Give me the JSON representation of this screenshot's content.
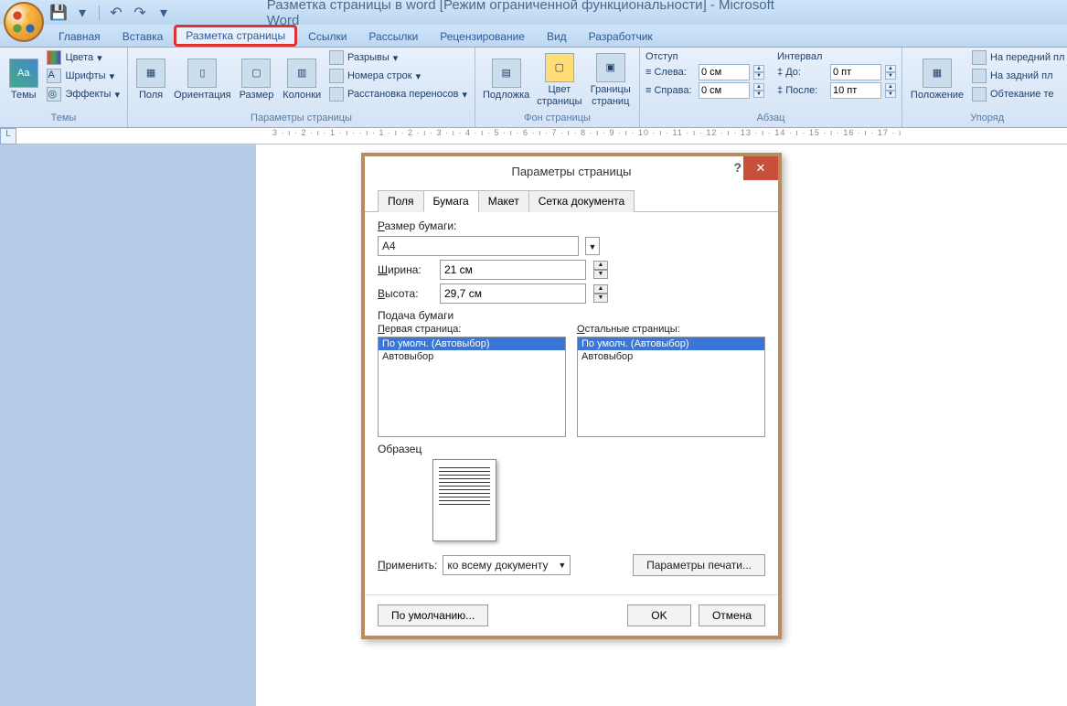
{
  "title": "Разметка страницы в word [Режим ограниченной функциональности] - Microsoft Word",
  "tabs": {
    "home": "Главная",
    "insert": "Вставка",
    "layout": "Разметка страницы",
    "refs": "Ссылки",
    "mail": "Рассылки",
    "review": "Рецензирование",
    "view": "Вид",
    "developer": "Разработчик"
  },
  "ribbon": {
    "themes": {
      "label": "Темы",
      "themes_btn": "Темы",
      "colors": "Цвета",
      "fonts": "Шрифты",
      "effects": "Эффекты"
    },
    "page_setup": {
      "label": "Параметры страницы",
      "margins": "Поля",
      "orientation": "Ориентация",
      "size": "Размер",
      "columns": "Колонки",
      "breaks": "Разрывы",
      "line_numbers": "Номера строк",
      "hyphenation": "Расстановка переносов"
    },
    "page_bg": {
      "label": "Фон страницы",
      "watermark": "Подложка",
      "page_color": "Цвет страницы",
      "borders": "Границы страниц"
    },
    "paragraph": {
      "label": "Абзац",
      "indent_title": "Отступ",
      "left": "Слева:",
      "right": "Справа:",
      "spacing_title": "Интервал",
      "before": "До:",
      "after": "После:",
      "left_val": "0 см",
      "right_val": "0 см",
      "before_val": "0 пт",
      "after_val": "10 пт"
    },
    "arrange": {
      "label": "Упоряд",
      "position": "Положение",
      "front": "На передний пл",
      "back": "На задний пл",
      "wrap": "Обтекание те"
    }
  },
  "ruler": "3 · ı · 2 · ı · 1 · ı ·  · ı · 1 · ı · 2 · ı · 3 · ı · 4 · ı · 5 · ı · 6 · ı · 7 · ı · 8 · ı · 9 · ı · 10 · ı · 11 · ı · 12 · ı · 13 · ı · 14 · ı · 15 · ı · 16 · ı · 17 · ı",
  "dialog": {
    "title": "Параметры страницы",
    "tabs": {
      "fields": "Поля",
      "paper": "Бумага",
      "layout": "Макет",
      "grid": "Сетка документа"
    },
    "paper_size_lbl": "Размер бумаги:",
    "paper_size_val": "A4",
    "width_lbl": "Ширина:",
    "width_val": "21 см",
    "height_lbl": "Высота:",
    "height_val": "29,7 см",
    "feed_lbl": "Подача бумаги",
    "first_page_lbl": "Первая страница:",
    "other_pages_lbl": "Остальные страницы:",
    "opt_default": "По умолч. (Автовыбор)",
    "opt_auto": "Автовыбор",
    "preview_lbl": "Образец",
    "apply_lbl": "Применить:",
    "apply_val": "ко всему документу",
    "print_opts": "Параметры печати...",
    "default_btn": "По умолчанию...",
    "ok": "OK",
    "cancel": "Отмена"
  }
}
